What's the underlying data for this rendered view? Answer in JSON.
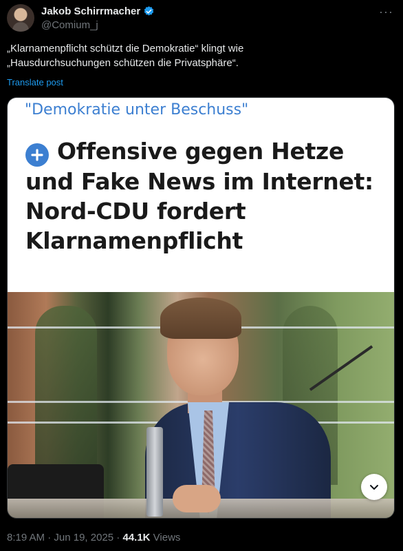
{
  "author": {
    "display_name": "Jakob Schirrmacher",
    "handle": "@Comium_j",
    "verified": true,
    "more_icon": "more-icon"
  },
  "tweet": {
    "line1": "„Klarnamenpflicht schützt die Demokratie“ klingt wie",
    "line2": "„Hausdurchsuchungen schützen die Privatsphäre“.",
    "translate_label": "Translate post"
  },
  "media": {
    "kicker": "\"Demokratie unter Beschuss\"",
    "headline_line1": "Offensive gegen Hetze",
    "headline_line2": "und Fake News im Internet:",
    "headline_line3": "Nord-CDU fordert",
    "headline_line4": "Klarnamenpflicht",
    "plus_icon": "plus-icon",
    "expand_icon": "chevron-down-icon"
  },
  "meta": {
    "time": "8:19 AM",
    "separator": " · ",
    "date": "Jun 19, 2025",
    "views_count": "44.1K",
    "views_label": " Views"
  },
  "colors": {
    "background": "#000000",
    "text": "#e7e9ea",
    "muted": "#71767b",
    "link": "#1d9bf0",
    "headline_accent": "#3c7fd1"
  }
}
